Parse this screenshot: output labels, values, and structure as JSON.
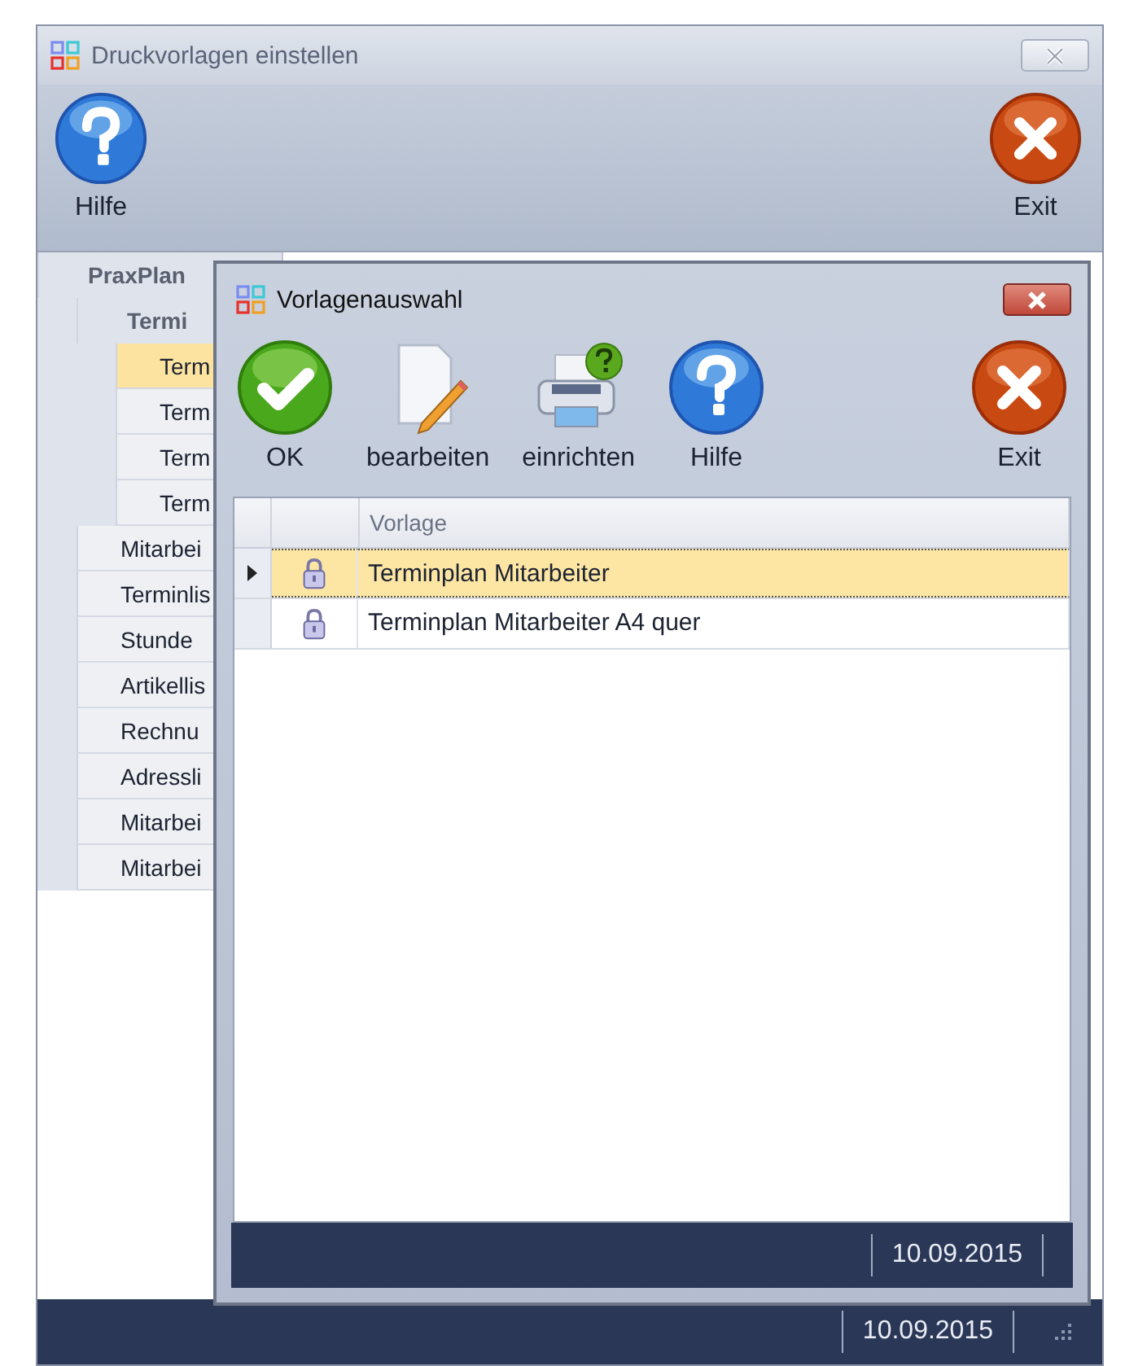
{
  "window": {
    "title": "Druckvorlagen einstellen"
  },
  "toolbar": [
    {
      "kind": "help",
      "label": "Hilfe"
    },
    {
      "kind": "exit",
      "label": "Exit"
    }
  ],
  "tree": [
    {
      "label": "PraxPlan",
      "selected": false,
      "children": [
        {
          "label": "Termi",
          "selected": false,
          "children": [
            {
              "label": "Term",
              "selected": true
            },
            {
              "label": "Term",
              "selected": false
            },
            {
              "label": "Term",
              "selected": false
            },
            {
              "label": "Term",
              "selected": false
            }
          ]
        },
        {
          "label": "Mitarbei",
          "selected": false
        },
        {
          "label": "Terminlis",
          "selected": false
        },
        {
          "label": "Stunde",
          "selected": false
        },
        {
          "label": "Artikellis",
          "selected": false
        },
        {
          "label": "Rechnu",
          "selected": false
        },
        {
          "label": "Adressli",
          "selected": false
        },
        {
          "label": "Mitarbei",
          "selected": false
        },
        {
          "label": "Mitarbei",
          "selected": false
        }
      ]
    }
  ],
  "status_bar": {
    "date": "10.09.2015"
  },
  "dialog": {
    "title": "Vorlagenauswahl",
    "toolbar": [
      {
        "kind": "ok",
        "label": "OK"
      },
      {
        "kind": "edit",
        "label": "bearbeiten"
      },
      {
        "kind": "printer",
        "label": "einrichten"
      },
      {
        "kind": "help",
        "label": "Hilfe"
      },
      {
        "kind": "exit",
        "label": "Exit"
      }
    ],
    "table": {
      "columns": [
        "Vorlage"
      ],
      "rows": [
        {
          "name": "Terminplan Mitarbeiter",
          "selected": true
        },
        {
          "name": "Terminplan Mitarbeiter A4 quer",
          "selected": false
        }
      ]
    },
    "status_bar": {
      "date": "10.09.2015"
    }
  }
}
